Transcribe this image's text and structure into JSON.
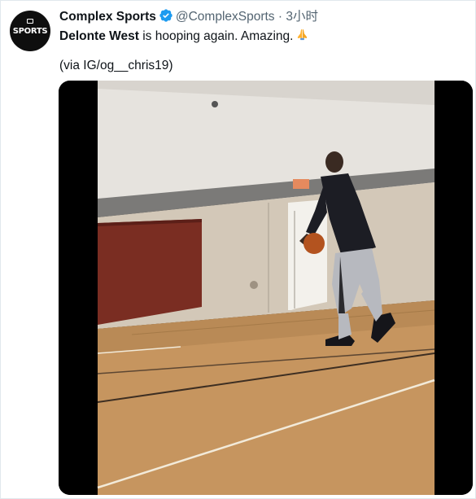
{
  "account": {
    "display_name": "Complex Sports",
    "handle": "@ComplexSports",
    "separator": "·",
    "time": "3小时",
    "avatar_text": "SPORTS",
    "verified_icon": "verified-badge-icon"
  },
  "tweet": {
    "mention_name": "Delonte West",
    "text": " is hooping again. Amazing.",
    "emoji": "folded-hands-emoji",
    "via": "(via IG/og__chris19)"
  },
  "media": {
    "type": "video",
    "description_icons": [
      "video-frame"
    ]
  },
  "colors": {
    "verified": "#1d9bf0",
    "secondary_text": "#536471",
    "court_floor": "#c6955f",
    "wall": "#d9d3ca",
    "gym_mat": "#7a2d22"
  }
}
